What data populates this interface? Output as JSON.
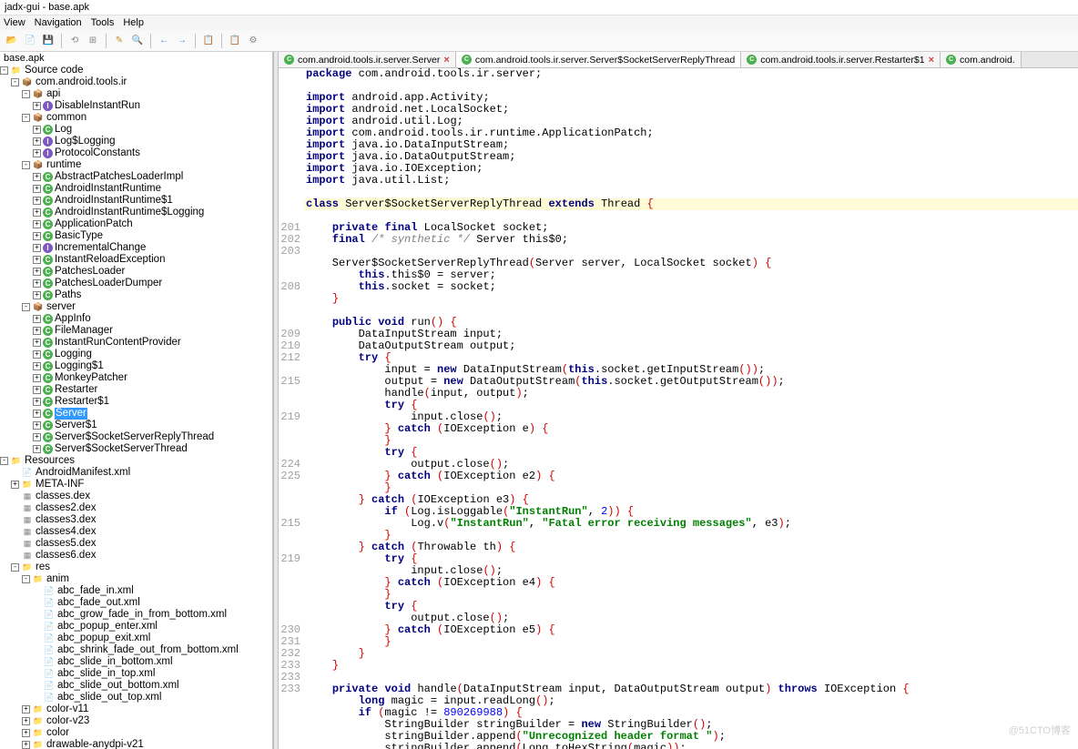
{
  "title": "jadx-gui - base.apk",
  "menu": {
    "view": "View",
    "navigation": "Navigation",
    "tools": "Tools",
    "help": "Help"
  },
  "project_file": "base.apk",
  "source_code_label": "Source code",
  "resources_label": "Resources",
  "root_pkg": "com.android.tools.ir",
  "tree": {
    "api": "api",
    "api_items": {
      "disable_ir": "DisableInstantRun"
    },
    "common": "common",
    "common_items": {
      "log": "Log",
      "log_logging": "Log$Logging",
      "protocol": "ProtocolConstants"
    },
    "runtime": "runtime",
    "runtime_items": {
      "apli": "AbstractPatchesLoaderImpl",
      "air": "AndroidInstantRuntime",
      "air1": "AndroidInstantRuntime$1",
      "airlog": "AndroidInstantRuntime$Logging",
      "ap": "ApplicationPatch",
      "bt": "BasicType",
      "ic": "IncrementalChange",
      "ire": "InstantReloadException",
      "pl": "PatchesLoader",
      "pld": "PatchesLoaderDumper",
      "paths": "Paths"
    },
    "server": "server",
    "server_items": {
      "ai": "AppInfo",
      "fm": "FileManager",
      "ircp": "InstantRunContentProvider",
      "log": "Logging",
      "log1": "Logging$1",
      "mp": "MonkeyPatcher",
      "rs": "Restarter",
      "rs1": "Restarter$1",
      "srv": "Server",
      "srv1": "Server$1",
      "ssrt": "Server$SocketServerReplyThread",
      "sst": "Server$SocketServerThread"
    },
    "manifest": "AndroidManifest.xml",
    "metainf": "META-INF",
    "dex": {
      "c1": "classes.dex",
      "c2": "classes2.dex",
      "c3": "classes3.dex",
      "c4": "classes4.dex",
      "c5": "classes5.dex",
      "c6": "classes6.dex"
    },
    "res": "res",
    "anim": "anim",
    "anim_items": {
      "f1": "abc_fade_in.xml",
      "f2": "abc_fade_out.xml",
      "f3": "abc_grow_fade_in_from_bottom.xml",
      "f4": "abc_popup_enter.xml",
      "f5": "abc_popup_exit.xml",
      "f6": "abc_shrink_fade_out_from_bottom.xml",
      "f7": "abc_slide_in_bottom.xml",
      "f8": "abc_slide_in_top.xml",
      "f9": "abc_slide_out_bottom.xml",
      "f10": "abc_slide_out_top.xml"
    },
    "color_v11": "color-v11",
    "color_v23": "color-v23",
    "color": "color",
    "drawable": "drawable-anydpi-v21"
  },
  "tabs": {
    "t1": "com.android.tools.ir.server.Server",
    "t2": "com.android.tools.ir.server.Server$SocketServerReplyThread",
    "t3": "com.android.tools.ir.server.Restarter$1",
    "t4": "com.android."
  },
  "line_numbers": [
    "",
    "",
    "",
    "",
    "",
    "",
    "",
    "",
    "",
    "",
    "",
    "",
    "",
    "201",
    "202",
    "203",
    "",
    "",
    "208",
    "",
    "",
    "",
    "209",
    "210",
    "212",
    "",
    "215",
    "",
    "",
    "219",
    "",
    "",
    "",
    "224",
    "225",
    "",
    "",
    "",
    "215",
    "",
    "",
    "219",
    "",
    "",
    "",
    "",
    "",
    "230",
    "231",
    "232",
    "233",
    "233",
    "233"
  ],
  "code": {
    "pkg": "package",
    "pkg_name": "com.android.tools.ir.server",
    "imp": "import",
    "imports": [
      "android.app.Activity",
      "android.net.LocalSocket",
      "android.util.Log",
      "com.android.tools.ir.runtime.ApplicationPatch",
      "java.io.DataInputStream",
      "java.io.DataOutputStream",
      "java.io.IOException",
      "java.util.List"
    ],
    "cls": "class",
    "ext": "extends",
    "cls_name": "Server$SocketServerReplyThread",
    "thread": "Thread",
    "priv": "private",
    "fin": "final",
    "pub": "public",
    "void": "void",
    "new": "new",
    "try": "try",
    "catch": "catch",
    "if": "if",
    "throws": "throws",
    "long": "long",
    "ls": "LocalSocket",
    "socket": "socket",
    "synth": "/* synthetic */",
    "server": "Server",
    "this0": "this$0",
    "this": "this",
    "srv_p": "server",
    "run": "run",
    "dis": "DataInputStream",
    "dos": "DataOutputStream",
    "input": "input",
    "output": "output",
    "gis": "getInputStream",
    "gos": "getOutputStream",
    "handle": "handle",
    "close": "close",
    "ioe": "IOException",
    "e": "e",
    "e2": "e2",
    "e3": "e3",
    "e4": "e4",
    "e5": "e5",
    "th": "th",
    "throwable": "Throwable",
    "loggable": "isLoggable",
    "logcls": "Log",
    "logv": "v",
    "ir_str": "\"InstantRun\"",
    "two": "2",
    "err_str": "\"Fatal error receiving messages\"",
    "magic": "magic",
    "readLong": "readLong",
    "magic_num": "890269988",
    "sb": "StringBuilder",
    "sb_var": "stringBuilder",
    "append": "append",
    "tohex": "toHexString",
    "long_cls": "Long",
    "hdr_str": "\"Unrecognized header format \""
  },
  "watermark": "@51CTO博客"
}
